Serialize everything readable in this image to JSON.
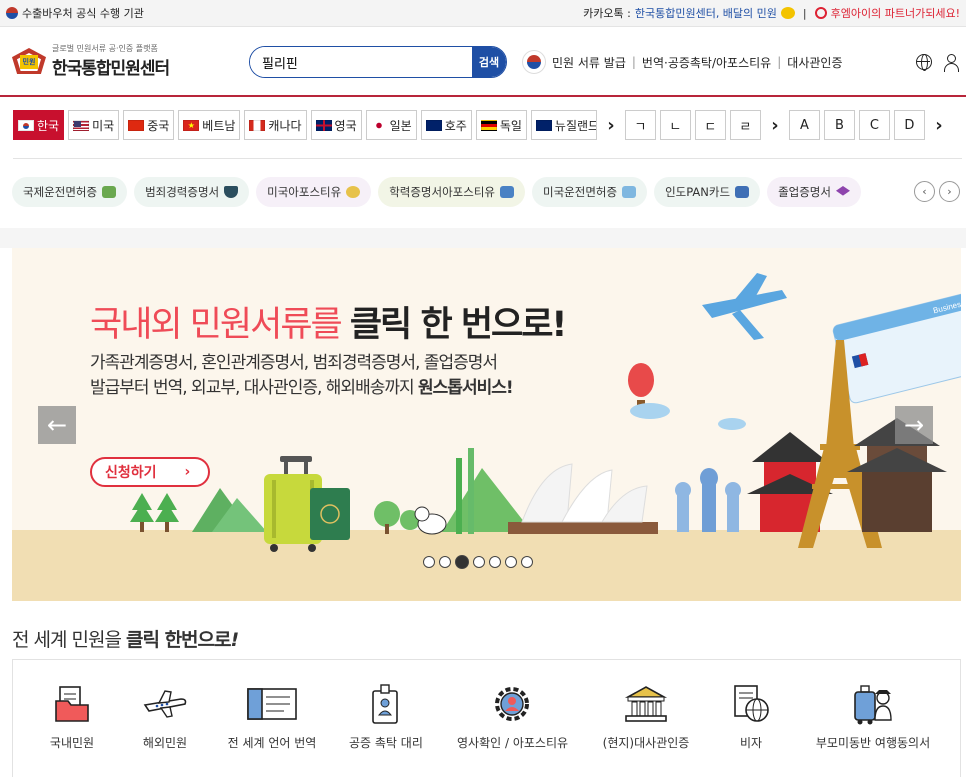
{
  "topbar": {
    "left_text": "수출바우처 공식 수행 기관",
    "kakao_label": "카카오톡 :",
    "kakao_channel": "한국통합민원센터, 배달의 민원",
    "partner_text": "후엠아이의 파트너가되세요!"
  },
  "header": {
    "logo_subtitle": "글로벌 민원서류 공·인증 플랫폼",
    "logo_title": "한국통합민원센터",
    "logo_mark_text": "민원",
    "search_value": "필리핀",
    "search_button": "검색",
    "nav": [
      "민원 서류 발급",
      "번역·공증촉탁/아포스티유",
      "대사관인증"
    ]
  },
  "countries": [
    {
      "label": "한국",
      "flag": "kr",
      "active": true
    },
    {
      "label": "미국",
      "flag": "us",
      "active": false
    },
    {
      "label": "중국",
      "flag": "cn",
      "active": false
    },
    {
      "label": "베트남",
      "flag": "vn",
      "active": false
    },
    {
      "label": "캐나다",
      "flag": "ca",
      "active": false
    },
    {
      "label": "영국",
      "flag": "gb",
      "active": false
    },
    {
      "label": "일본",
      "flag": "jp",
      "active": false
    },
    {
      "label": "호주",
      "flag": "au",
      "active": false
    },
    {
      "label": "독일",
      "flag": "de",
      "active": false
    },
    {
      "label": "뉴질랜드",
      "flag": "nz",
      "active": false
    }
  ],
  "korean_index": [
    "ㄱ",
    "ㄴ",
    "ㄷ",
    "ㄹ"
  ],
  "alpha_index": [
    "A",
    "B",
    "C",
    "D"
  ],
  "chips": [
    {
      "label": "국제운전면허증",
      "bg": "#eef5f2"
    },
    {
      "label": "범죄경력증명서",
      "bg": "#eef5f2"
    },
    {
      "label": "미국아포스티유",
      "bg": "#f6f0f8"
    },
    {
      "label": "학력증명서아포스티유",
      "bg": "#f2f5e6"
    },
    {
      "label": "미국운전면허증",
      "bg": "#eef5f2"
    },
    {
      "label": "인도PAN카드",
      "bg": "#eef5f2"
    },
    {
      "label": "졸업증명서",
      "bg": "#f6f0f8"
    }
  ],
  "hero": {
    "title_red": "국내외 민원서류를 ",
    "title_bold": "클릭 한 번으로!",
    "line1": "가족관계증명서, 혼인관계증명서, 범죄경력증명서, 졸업증명서",
    "line2_plain": "발급부터 번역, 외교부, 대사관인증, 해외배송까지 ",
    "line2_bold": "원스톱서비스!",
    "apply_label": "신청하기",
    "ticket_label": "Business",
    "slide_count": 7,
    "active_slide": 3
  },
  "section": {
    "title_plain": "전 세계 민원을 ",
    "title_bold": "클릭 한번으로",
    "title_mark": "!"
  },
  "services": [
    {
      "label": "국내민원",
      "icon": "folder-document-icon"
    },
    {
      "label": "해외민원",
      "icon": "airplane-icon"
    },
    {
      "label": "전 세계 언어 번역",
      "icon": "ticket-document-icon"
    },
    {
      "label": "공증 촉탁 대리",
      "icon": "id-badge-icon"
    },
    {
      "label": "영사확인 / 아포스티유",
      "icon": "gear-person-icon"
    },
    {
      "label": "(현지)대사관인증",
      "icon": "embassy-building-icon"
    },
    {
      "label": "비자",
      "icon": "visa-globe-icon"
    },
    {
      "label": "부모미동반 여행동의서",
      "icon": "traveler-luggage-icon"
    }
  ],
  "colors": {
    "brand_red": "#c8102e",
    "brand_blue": "#1f4fa5",
    "hero_title": "#ef4b57"
  }
}
